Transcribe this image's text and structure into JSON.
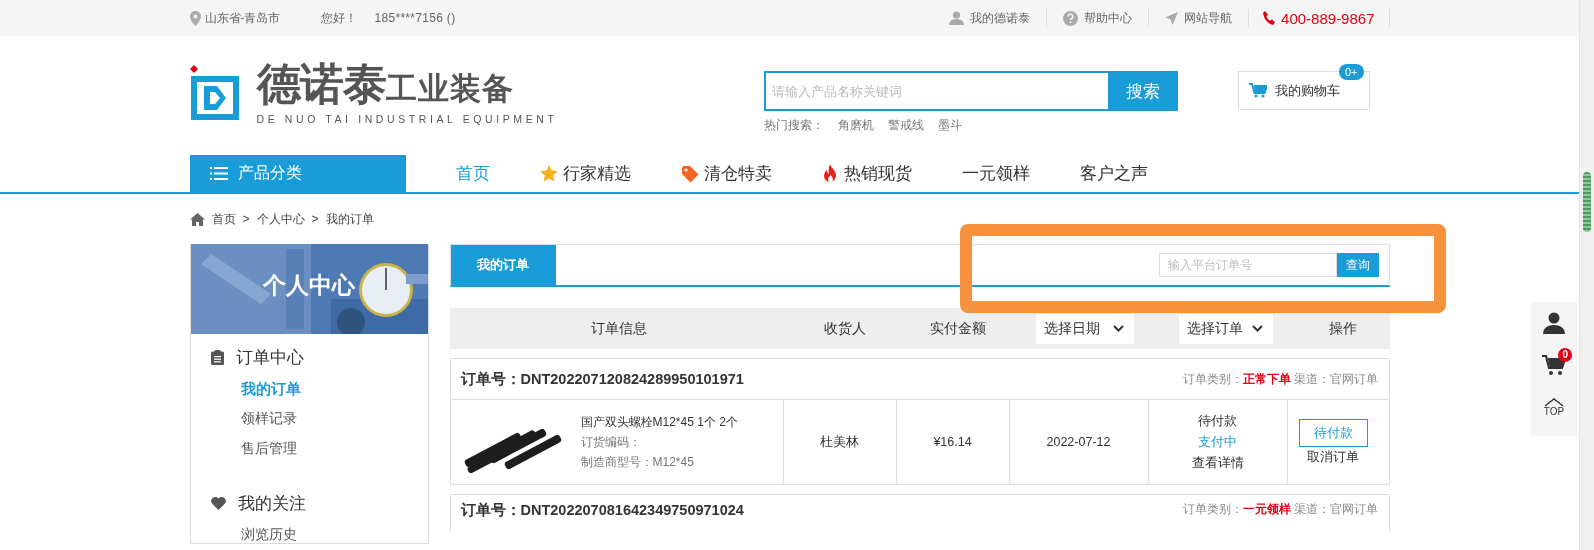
{
  "top_bar": {
    "location": "山东省-青岛市",
    "greeting": "您好！",
    "user": "185****7156",
    "user_suffix": "()",
    "links": [
      {
        "label": "我的德诺泰"
      },
      {
        "label": "帮助中心"
      },
      {
        "label": "网站导航"
      }
    ],
    "hotline": "400-889-9867"
  },
  "header": {
    "logo_title": "德诺泰",
    "logo_subtitle": "工业装备",
    "logo_english": "DE NUO TAI INDUSTRIAL EQUIPMENT",
    "search": {
      "placeholder": "请输入产品名称关键词",
      "button": "搜索"
    },
    "hot_label": "热门搜索：",
    "hot_terms": [
      "角磨机",
      "警戒线",
      "墨斗"
    ],
    "cart": {
      "label": "我的购物车",
      "badge": "0+"
    }
  },
  "nav": {
    "category": "产品分类",
    "items": [
      {
        "label": "首页",
        "selected": true
      },
      {
        "label": "行家精选",
        "selected": false
      },
      {
        "label": "清仓特卖",
        "selected": false
      },
      {
        "label": "热销现货",
        "selected": false
      },
      {
        "label": "一元领样",
        "selected": false
      },
      {
        "label": "客户之声",
        "selected": false
      }
    ]
  },
  "breadcrumb": [
    {
      "kind": "home",
      "text": "首页"
    },
    {
      "kind": "sep",
      "text": ">"
    },
    {
      "kind": "link",
      "text": "个人中心"
    },
    {
      "kind": "sep",
      "text": ">"
    },
    {
      "kind": "current",
      "text": "我的订单"
    }
  ],
  "sidebar": {
    "title": "个人中心",
    "groups": [
      {
        "title": "订单中心",
        "items": [
          {
            "label": "我的订单",
            "selected": true
          },
          {
            "label": "领样记录",
            "selected": false
          },
          {
            "label": "售后管理",
            "selected": false
          }
        ]
      },
      {
        "title": "我的关注",
        "items": [
          {
            "label": "浏览历史",
            "selected": false
          }
        ]
      }
    ]
  },
  "orders": {
    "tab": "我的订单",
    "search": {
      "placeholder": "输入平台订单号",
      "button": "查询"
    },
    "columns": [
      {
        "kind": "text",
        "label": "订单信息"
      },
      {
        "kind": "text",
        "label": "收货人"
      },
      {
        "kind": "text",
        "label": "实付金额"
      },
      {
        "kind": "select",
        "label": "选择日期"
      },
      {
        "kind": "select",
        "label": "选择订单"
      },
      {
        "kind": "text",
        "label": "操作"
      }
    ],
    "list": [
      {
        "number_label": "订单号：",
        "number": "DNT202207120824289950101971",
        "category_label": "订单类别：",
        "category": "正常下单",
        "channel_label": "渠道：",
        "channel": "官网订单",
        "item": {
          "name": "国产双头螺栓M12*45 1个 2个",
          "code_label": "订货编码：",
          "model": "制造商型号：M12*45"
        },
        "receiver": "杜美林",
        "amount": "¥16.14",
        "date": "2022-07-12",
        "status": "待付款",
        "pay_link": "支付中",
        "detail_link": "查看详情",
        "action_button": "待付款",
        "cancel_link": "取消订单"
      },
      {
        "number_label": "订单号：",
        "number": "DNT202207081642349750971024",
        "category_label": "订单类别：",
        "category": "一元领样",
        "channel_label": "渠道：",
        "channel": "官网订单"
      }
    ]
  },
  "float_bar": {
    "cart_badge": "0",
    "top_label": "TOP"
  }
}
